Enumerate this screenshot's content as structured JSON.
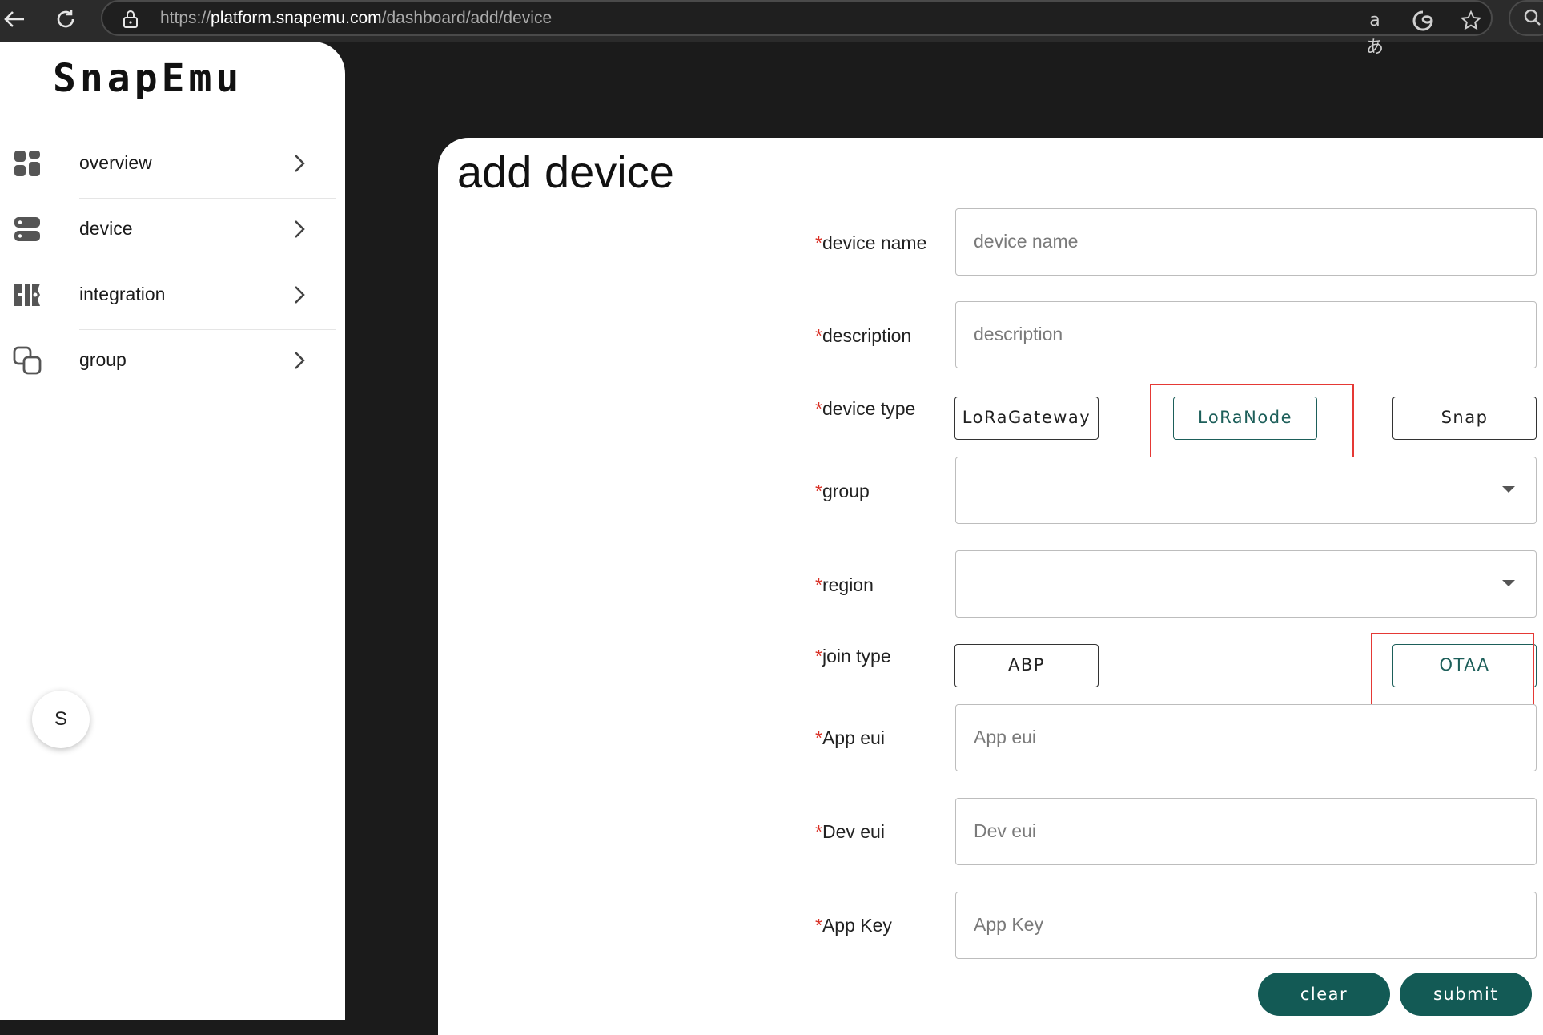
{
  "browser": {
    "url_prefix": "https://",
    "url_domain": "platform.snapemu.com",
    "url_path": "/dashboard/add/device",
    "icons": [
      "back-arrow-icon",
      "reload-icon",
      "lock-icon",
      "read-aloud-icon",
      "edge-icon",
      "favorite-star-icon",
      "search-icon"
    ]
  },
  "sidebar": {
    "logo": "SnapEmu",
    "items": [
      {
        "label": "overview",
        "icon": "overview-grid-icon"
      },
      {
        "label": "device",
        "icon": "device-server-icon"
      },
      {
        "label": "integration",
        "icon": "integration-icon"
      },
      {
        "label": "group",
        "icon": "group-squares-icon"
      }
    ],
    "fab_label": "S"
  },
  "form": {
    "title": "add device",
    "required_mark": "*",
    "device_name": {
      "label": "device name",
      "placeholder": "device name",
      "value": ""
    },
    "description": {
      "label": "description",
      "placeholder": "description",
      "value": ""
    },
    "device_type": {
      "label": "device type",
      "options": [
        "LoRaGateway",
        "LoRaNode",
        "Snap"
      ],
      "selected": "LoRaNode"
    },
    "group": {
      "label": "group",
      "value": ""
    },
    "region": {
      "label": "region",
      "value": ""
    },
    "join_type": {
      "label": "join type",
      "options": [
        "ABP",
        "OTAA"
      ],
      "selected": "OTAA"
    },
    "app_eui": {
      "label": "App eui",
      "placeholder": "App eui",
      "value": ""
    },
    "dev_eui": {
      "label": "Dev eui",
      "placeholder": "Dev eui",
      "value": ""
    },
    "app_key": {
      "label": "App Key",
      "placeholder": "App Key",
      "value": ""
    },
    "clear_label": "clear",
    "submit_label": "submit"
  },
  "colors": {
    "accent": "#135a55",
    "selected_border": "#1d5f5a",
    "required": "#d93025",
    "highlight": "#e53935",
    "page_bg": "#1b1b1b",
    "browser_bar": "#2b2b2b"
  }
}
